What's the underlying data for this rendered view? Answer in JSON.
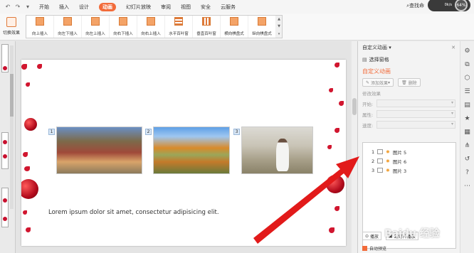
{
  "menubar": {
    "tabs": [
      "开始",
      "插入",
      "设计",
      "动画",
      "幻灯片放映",
      "审阅",
      "视图",
      "安全",
      "云服务"
    ],
    "active_tab": "动画",
    "search_label": "查找命",
    "badge_percent": "64%",
    "badge_speed": "0k/s"
  },
  "ribbon": {
    "switch_label": "切换效果",
    "gallery": [
      "向上插入",
      "向左下插入",
      "向左上插入",
      "向右下插入",
      "向右上插入",
      "水平百叶窗",
      "垂直百叶窗",
      "横向棋盘式",
      "纵向棋盘式"
    ]
  },
  "panel": {
    "header": "自定义动画",
    "select_pane": "选择窗格",
    "section_title": "自定义动画",
    "add_effect": "添加效果",
    "delete": "删除",
    "modify_title": "修改效果",
    "start_label": "开始:",
    "property_label": "属性:",
    "speed_label": "速度:",
    "items": [
      {
        "num": "1",
        "label": "图片 5"
      },
      {
        "num": "2",
        "label": "图片 6"
      },
      {
        "num": "3",
        "label": "图片 3"
      }
    ],
    "play_button": "播放",
    "slideshow_button": "幻灯片播放",
    "auto_preview": "自动预览"
  },
  "slide": {
    "numbers": [
      "1",
      "2",
      "3"
    ],
    "text": "Lorem ipsum dolor sit amet, consectetur adipisicing elit."
  },
  "watermark": "Baidu 经验"
}
